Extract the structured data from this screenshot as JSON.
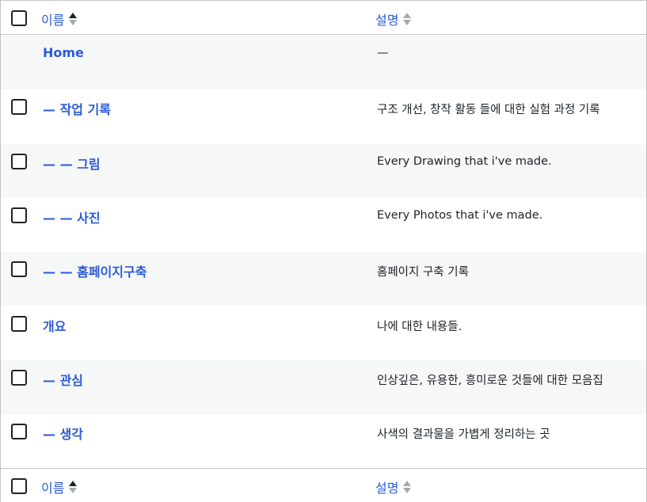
{
  "header": {
    "name_label": "이름",
    "desc_label": "설명"
  },
  "footer": {
    "name_label": "이름",
    "desc_label": "설명"
  },
  "rows": [
    {
      "name": "Home",
      "description": "—",
      "has_checkbox": false
    },
    {
      "name": "— 작업 기록",
      "description": "구조 개선, 창작 활동 들에 대한 실험 과정 기록",
      "has_checkbox": true
    },
    {
      "name": "— — 그림",
      "description": "Every Drawing that i've made.",
      "has_checkbox": true
    },
    {
      "name": "— — 사진",
      "description": "Every Photos that i've made.",
      "has_checkbox": true
    },
    {
      "name": "— — 홈페이지구축",
      "description": "홈페이지 구축 기록",
      "has_checkbox": true
    },
    {
      "name": "개요",
      "description": "나에 대한 내용들.",
      "has_checkbox": true
    },
    {
      "name": "— 관심",
      "description": "인상깊은, 유용한, 흥미로운 것들에 대한 모음집",
      "has_checkbox": true
    },
    {
      "name": "— 생각",
      "description": "사색의 결과물을 가볍게 정리하는 곳",
      "has_checkbox": true
    }
  ],
  "colors": {
    "link": "#2b5bd7",
    "alt_row": "#f6f7f7",
    "border": "#c3c4c7"
  }
}
